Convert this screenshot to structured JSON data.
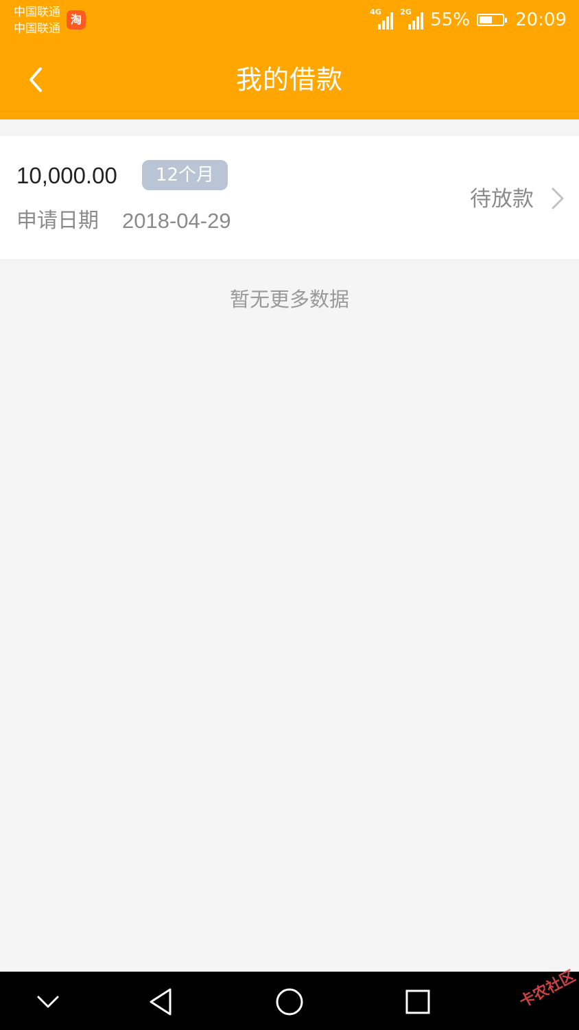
{
  "status_bar": {
    "carrier_1": "中国联通",
    "carrier_2": "中国联通",
    "taobao_icon_text": "淘",
    "network_1": "4G",
    "network_2": "2G",
    "battery_percent": "55%",
    "battery_level": 0.55,
    "time": "20:09"
  },
  "header": {
    "title": "我的借款"
  },
  "loan": {
    "amount": "10,000.00",
    "term": "12个月",
    "apply_label": "申请日期",
    "apply_date": "2018-04-29",
    "status": "待放款"
  },
  "empty_state": {
    "text": "暂无更多数据"
  },
  "watermark": {
    "text": "卡农社区"
  },
  "colors": {
    "header_bg": "#ffa600",
    "term_badge_bg": "#b9c5d5",
    "page_bg": "#f5f5f5",
    "nav_bg": "#000000"
  }
}
